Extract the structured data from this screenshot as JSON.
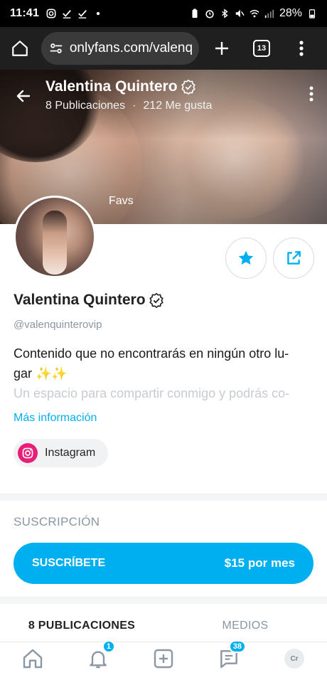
{
  "status_bar": {
    "time": "11:41",
    "battery": "28%"
  },
  "browser": {
    "url": "onlyfans.com/valenq",
    "tab_count": "13"
  },
  "profile": {
    "name": "Valentina Quintero",
    "publications": "8 Publicaciones",
    "likes": "212 Me gusta",
    "banner_label": "Favs",
    "handle": "@valenquinterovip",
    "bio_line1": "Contenido que no encontrarás en ningún otro lu-",
    "bio_line2": "gar ✨✨",
    "bio_line3": "Un espacio para compartir conmigo y podrás co-",
    "more_info": "Más información",
    "social_chip": "Instagram"
  },
  "subscription": {
    "section_title": "SUSCRIPCIÓN",
    "button_label": "SUSCRÍBETE",
    "price": "$15 por mes"
  },
  "tabs": [
    {
      "label": "8 PUBLICACIONES",
      "active": true
    },
    {
      "label": "MEDIOS",
      "active": false
    }
  ],
  "bottom_nav": {
    "notifications_badge": "1",
    "messages_badge": "38",
    "avatar_initials": "Cr"
  },
  "colors": {
    "accent": "#00aff0",
    "instagram": "#e91e79"
  }
}
